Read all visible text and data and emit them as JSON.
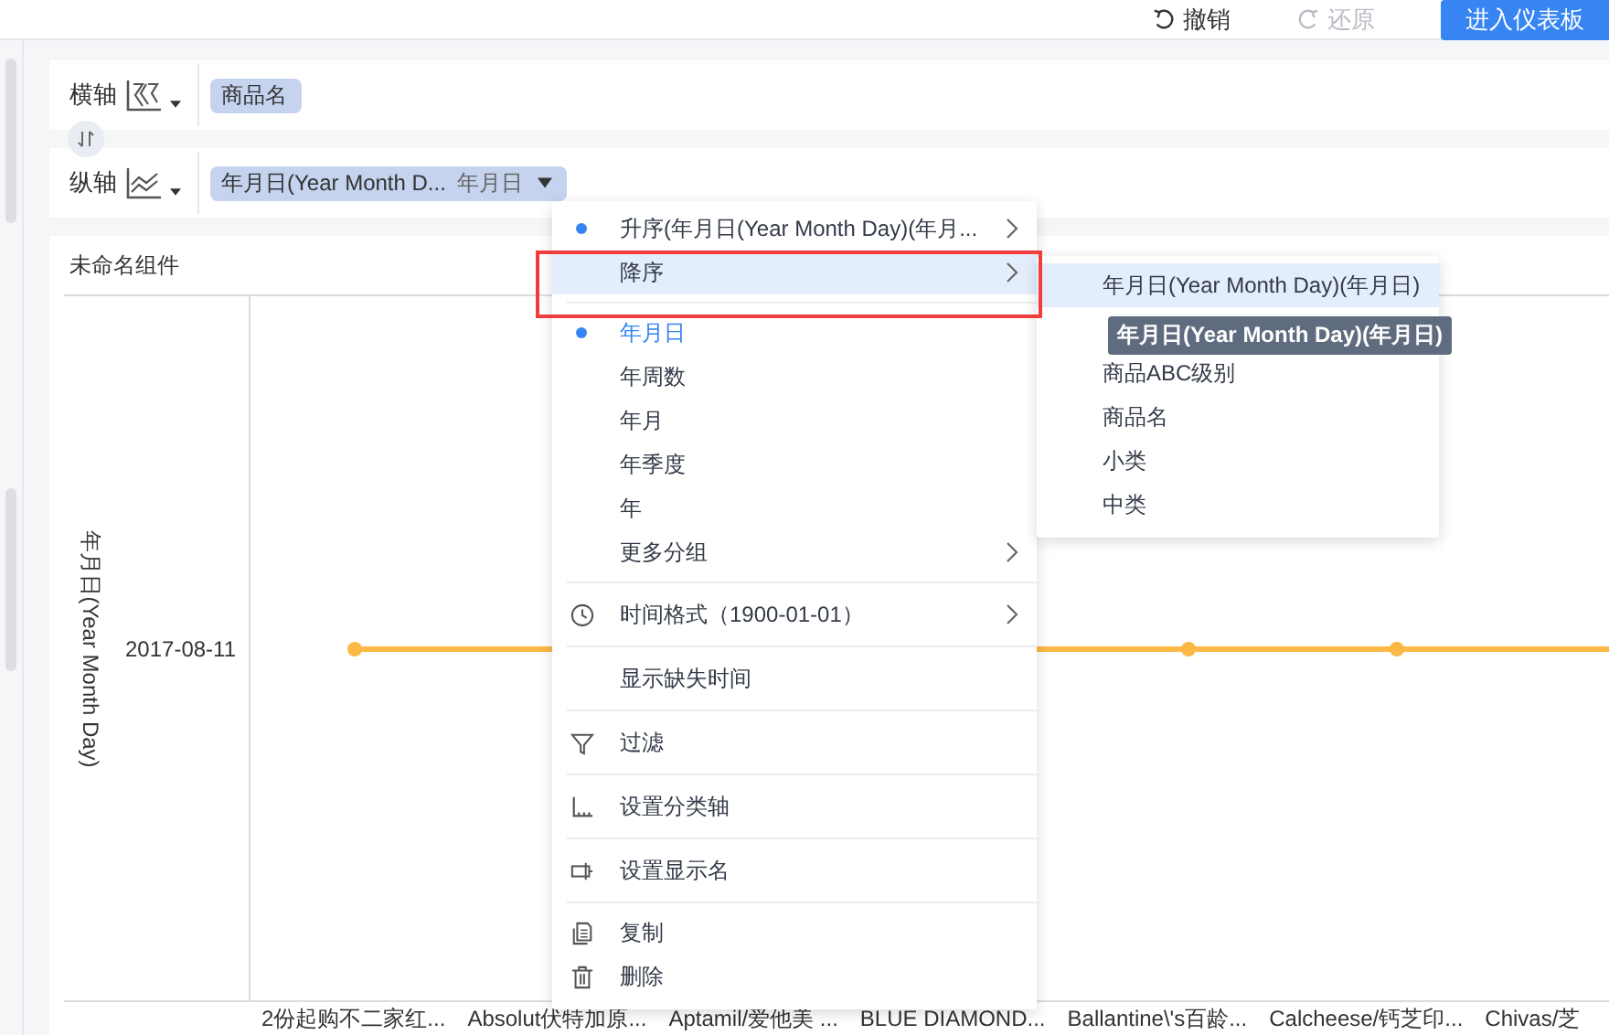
{
  "toolbar": {
    "undo": {
      "label": "撤销",
      "disabled": false
    },
    "redo": {
      "label": "还原",
      "disabled": true
    },
    "primary_button": "进入仪表板"
  },
  "axes": [
    {
      "label": "横轴",
      "chips": [
        {
          "text": "商品名",
          "has_caret": false
        }
      ]
    },
    {
      "label": "纵轴",
      "chips": [
        {
          "text": "年月日(Year Month D...",
          "secondary": "年月日",
          "has_caret": true
        }
      ]
    }
  ],
  "chart_card": {
    "title": "未命名组件",
    "y_axis_title": "年月日(Year Month Day)",
    "y_ticks": [
      "2017-08-11"
    ],
    "x_labels": [
      "2份起购不二家红...",
      "Absolut伏特加原...",
      "Aptamil/爱他美 ...",
      "BLUE DIAMOND...",
      "Ballantine\\'s百龄...",
      "Calcheese/钙芝印...",
      "Chivas/芝"
    ]
  },
  "menu": {
    "sections": [
      [
        {
          "kind": "sort",
          "label": "升序(年月日(Year Month Day)(年月...",
          "selected": true,
          "has_submenu": true,
          "highlighted": false
        },
        {
          "kind": "sort",
          "label": "降序",
          "selected": false,
          "has_submenu": true,
          "highlighted": true
        }
      ],
      [
        {
          "kind": "group",
          "label": "年月日",
          "selected": true,
          "has_submenu": false,
          "highlighted": false
        },
        {
          "kind": "group",
          "label": "年周数",
          "selected": false,
          "has_submenu": false,
          "highlighted": false
        },
        {
          "kind": "group",
          "label": "年月",
          "selected": false,
          "has_submenu": false,
          "highlighted": false
        },
        {
          "kind": "group",
          "label": "年季度",
          "selected": false,
          "has_submenu": false,
          "highlighted": false
        },
        {
          "kind": "group",
          "label": "年",
          "selected": false,
          "has_submenu": false,
          "highlighted": false
        },
        {
          "kind": "plain",
          "label": "更多分组",
          "has_submenu": true,
          "highlighted": false
        }
      ],
      [
        {
          "kind": "time",
          "label": "时间格式（1900-01-01）",
          "has_submenu": true,
          "highlighted": false
        }
      ],
      [
        {
          "kind": "plain",
          "label": "显示缺失时间",
          "has_submenu": false,
          "highlighted": false
        }
      ],
      [
        {
          "kind": "filter",
          "label": "过滤",
          "has_submenu": false,
          "highlighted": false
        }
      ],
      [
        {
          "kind": "axis",
          "label": "设置分类轴",
          "has_submenu": false,
          "highlighted": false
        }
      ],
      [
        {
          "kind": "rename",
          "label": "设置显示名",
          "has_submenu": false,
          "highlighted": false
        }
      ],
      [
        {
          "kind": "copy",
          "label": "复制",
          "has_submenu": false,
          "highlighted": false
        },
        {
          "kind": "delete",
          "label": "删除",
          "has_submenu": false,
          "highlighted": false
        }
      ]
    ]
  },
  "submenu": {
    "items": [
      {
        "label": "年月日(Year Month Day)(年月日)",
        "highlighted": true
      },
      {
        "highlighted": false
      },
      {
        "label": "商品ABC级别",
        "highlighted": false
      },
      {
        "label": "商品名",
        "highlighted": false
      },
      {
        "label": "小类",
        "highlighted": false
      },
      {
        "label": "中类",
        "highlighted": false
      }
    ],
    "tooltip": "年月日(Year Month Day)(年月日)"
  },
  "annotation": {
    "highlight_frame": true
  }
}
